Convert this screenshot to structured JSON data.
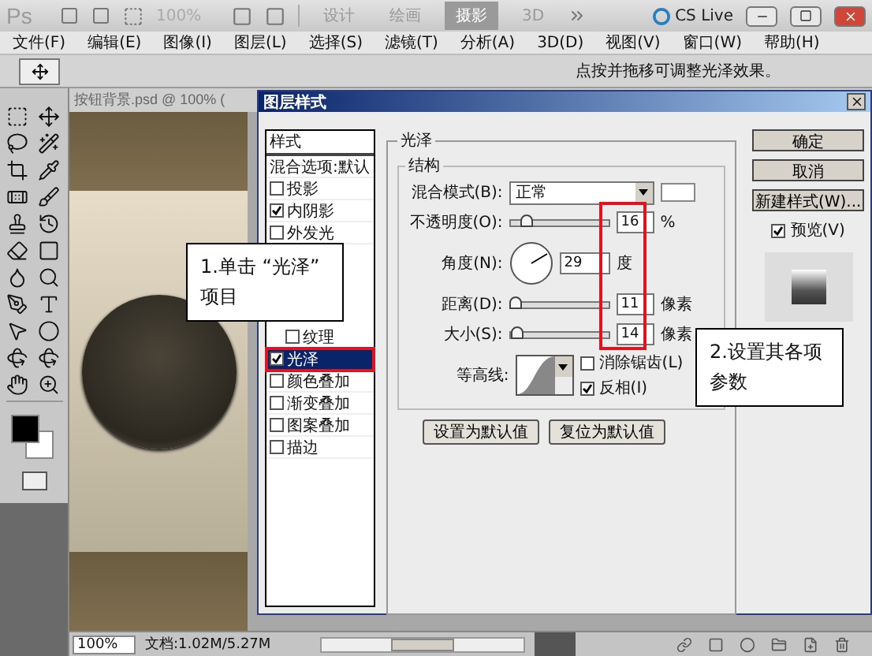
{
  "app_bar": {
    "logo": "Ps",
    "zoom": "100%",
    "workspaces": [
      {
        "label": "设计",
        "selected": false
      },
      {
        "label": "绘画",
        "selected": false
      },
      {
        "label": "摄影",
        "selected": true
      },
      {
        "label": "3D",
        "selected": false
      }
    ],
    "cs_live": "CS Live"
  },
  "menu": [
    "文件(F)",
    "编辑(E)",
    "图像(I)",
    "图层(L)",
    "选择(S)",
    "滤镜(T)",
    "分析(A)",
    "3D(D)",
    "视图(V)",
    "窗口(W)",
    "帮助(H)"
  ],
  "options_bar": {
    "hint": "点按并拖移可调整光泽效果。"
  },
  "document": {
    "tab": "按钮背景.psd @ 100% (",
    "zoom": "100%",
    "status": "文档:1.02M/5.27M"
  },
  "dialog": {
    "title": "图层样式",
    "styles_header": "样式",
    "blend_options": "混合选项:默认",
    "styles": [
      {
        "label": "投影",
        "kind": "main",
        "checked": false,
        "selected": false
      },
      {
        "label": "内阴影",
        "kind": "main",
        "checked": true,
        "selected": false
      },
      {
        "label": "外发光",
        "kind": "main",
        "checked": false,
        "selected": false
      },
      {
        "label": "纹理",
        "kind": "sub",
        "checked": false,
        "selected": false
      },
      {
        "label": "光泽",
        "kind": "main",
        "checked": true,
        "selected": true
      },
      {
        "label": "颜色叠加",
        "kind": "main",
        "checked": false,
        "selected": false
      },
      {
        "label": "渐变叠加",
        "kind": "main",
        "checked": false,
        "selected": false
      },
      {
        "label": "图案叠加",
        "kind": "main",
        "checked": false,
        "selected": false
      },
      {
        "label": "描边",
        "kind": "main",
        "checked": false,
        "selected": false
      }
    ],
    "section": "光泽",
    "group": "结构",
    "blend_mode": {
      "label": "混合模式(B):",
      "value": "正常"
    },
    "opacity": {
      "label": "不透明度(O):",
      "level": 0.16,
      "value": "16",
      "unit": "%"
    },
    "angle": {
      "label": "角度(N):",
      "value": "29",
      "unit": "度"
    },
    "distance": {
      "label": "距离(D):",
      "level": 0.05,
      "value": "11",
      "unit": "像素"
    },
    "size": {
      "label": "大小(S):",
      "level": 0.07,
      "value": "14",
      "unit": "像素"
    },
    "contour": {
      "label": "等高线:"
    },
    "anti_alias": {
      "label": "消除锯齿(L)",
      "checked": false
    },
    "invert": {
      "label": "反相(I)",
      "checked": true
    },
    "buttons": [
      "设置为默认值",
      "复位为默认值"
    ],
    "actions": [
      "确定",
      "取消",
      "新建样式(W)..."
    ],
    "preview": {
      "label": "预览(V)",
      "checked": true
    }
  },
  "callouts": [
    {
      "lines": [
        "1.单击 “光泽”",
        "项目"
      ]
    },
    {
      "lines": [
        "2.设置其各项",
        "参数"
      ]
    }
  ]
}
